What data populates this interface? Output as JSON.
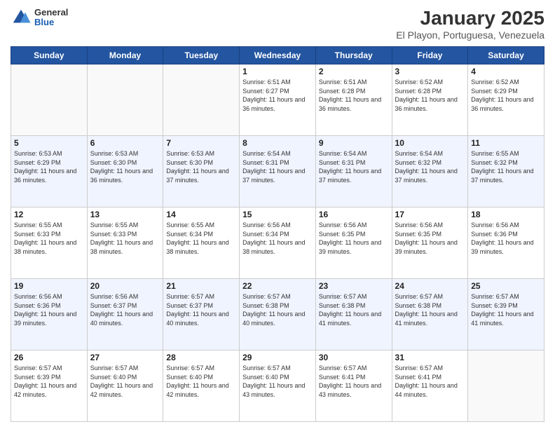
{
  "header": {
    "logo_general": "General",
    "logo_blue": "Blue",
    "main_title": "January 2025",
    "subtitle": "El Playon, Portuguesa, Venezuela"
  },
  "calendar": {
    "days_of_week": [
      "Sunday",
      "Monday",
      "Tuesday",
      "Wednesday",
      "Thursday",
      "Friday",
      "Saturday"
    ],
    "weeks": [
      [
        {
          "day": "",
          "sunrise": "",
          "sunset": "",
          "daylight": "",
          "empty": true
        },
        {
          "day": "",
          "sunrise": "",
          "sunset": "",
          "daylight": "",
          "empty": true
        },
        {
          "day": "",
          "sunrise": "",
          "sunset": "",
          "daylight": "",
          "empty": true
        },
        {
          "day": "1",
          "sunrise": "Sunrise: 6:51 AM",
          "sunset": "Sunset: 6:27 PM",
          "daylight": "Daylight: 11 hours and 36 minutes.",
          "empty": false
        },
        {
          "day": "2",
          "sunrise": "Sunrise: 6:51 AM",
          "sunset": "Sunset: 6:28 PM",
          "daylight": "Daylight: 11 hours and 36 minutes.",
          "empty": false
        },
        {
          "day": "3",
          "sunrise": "Sunrise: 6:52 AM",
          "sunset": "Sunset: 6:28 PM",
          "daylight": "Daylight: 11 hours and 36 minutes.",
          "empty": false
        },
        {
          "day": "4",
          "sunrise": "Sunrise: 6:52 AM",
          "sunset": "Sunset: 6:29 PM",
          "daylight": "Daylight: 11 hours and 36 minutes.",
          "empty": false
        }
      ],
      [
        {
          "day": "5",
          "sunrise": "Sunrise: 6:53 AM",
          "sunset": "Sunset: 6:29 PM",
          "daylight": "Daylight: 11 hours and 36 minutes.",
          "empty": false
        },
        {
          "day": "6",
          "sunrise": "Sunrise: 6:53 AM",
          "sunset": "Sunset: 6:30 PM",
          "daylight": "Daylight: 11 hours and 36 minutes.",
          "empty": false
        },
        {
          "day": "7",
          "sunrise": "Sunrise: 6:53 AM",
          "sunset": "Sunset: 6:30 PM",
          "daylight": "Daylight: 11 hours and 37 minutes.",
          "empty": false
        },
        {
          "day": "8",
          "sunrise": "Sunrise: 6:54 AM",
          "sunset": "Sunset: 6:31 PM",
          "daylight": "Daylight: 11 hours and 37 minutes.",
          "empty": false
        },
        {
          "day": "9",
          "sunrise": "Sunrise: 6:54 AM",
          "sunset": "Sunset: 6:31 PM",
          "daylight": "Daylight: 11 hours and 37 minutes.",
          "empty": false
        },
        {
          "day": "10",
          "sunrise": "Sunrise: 6:54 AM",
          "sunset": "Sunset: 6:32 PM",
          "daylight": "Daylight: 11 hours and 37 minutes.",
          "empty": false
        },
        {
          "day": "11",
          "sunrise": "Sunrise: 6:55 AM",
          "sunset": "Sunset: 6:32 PM",
          "daylight": "Daylight: 11 hours and 37 minutes.",
          "empty": false
        }
      ],
      [
        {
          "day": "12",
          "sunrise": "Sunrise: 6:55 AM",
          "sunset": "Sunset: 6:33 PM",
          "daylight": "Daylight: 11 hours and 38 minutes.",
          "empty": false
        },
        {
          "day": "13",
          "sunrise": "Sunrise: 6:55 AM",
          "sunset": "Sunset: 6:33 PM",
          "daylight": "Daylight: 11 hours and 38 minutes.",
          "empty": false
        },
        {
          "day": "14",
          "sunrise": "Sunrise: 6:55 AM",
          "sunset": "Sunset: 6:34 PM",
          "daylight": "Daylight: 11 hours and 38 minutes.",
          "empty": false
        },
        {
          "day": "15",
          "sunrise": "Sunrise: 6:56 AM",
          "sunset": "Sunset: 6:34 PM",
          "daylight": "Daylight: 11 hours and 38 minutes.",
          "empty": false
        },
        {
          "day": "16",
          "sunrise": "Sunrise: 6:56 AM",
          "sunset": "Sunset: 6:35 PM",
          "daylight": "Daylight: 11 hours and 39 minutes.",
          "empty": false
        },
        {
          "day": "17",
          "sunrise": "Sunrise: 6:56 AM",
          "sunset": "Sunset: 6:35 PM",
          "daylight": "Daylight: 11 hours and 39 minutes.",
          "empty": false
        },
        {
          "day": "18",
          "sunrise": "Sunrise: 6:56 AM",
          "sunset": "Sunset: 6:36 PM",
          "daylight": "Daylight: 11 hours and 39 minutes.",
          "empty": false
        }
      ],
      [
        {
          "day": "19",
          "sunrise": "Sunrise: 6:56 AM",
          "sunset": "Sunset: 6:36 PM",
          "daylight": "Daylight: 11 hours and 39 minutes.",
          "empty": false
        },
        {
          "day": "20",
          "sunrise": "Sunrise: 6:56 AM",
          "sunset": "Sunset: 6:37 PM",
          "daylight": "Daylight: 11 hours and 40 minutes.",
          "empty": false
        },
        {
          "day": "21",
          "sunrise": "Sunrise: 6:57 AM",
          "sunset": "Sunset: 6:37 PM",
          "daylight": "Daylight: 11 hours and 40 minutes.",
          "empty": false
        },
        {
          "day": "22",
          "sunrise": "Sunrise: 6:57 AM",
          "sunset": "Sunset: 6:38 PM",
          "daylight": "Daylight: 11 hours and 40 minutes.",
          "empty": false
        },
        {
          "day": "23",
          "sunrise": "Sunrise: 6:57 AM",
          "sunset": "Sunset: 6:38 PM",
          "daylight": "Daylight: 11 hours and 41 minutes.",
          "empty": false
        },
        {
          "day": "24",
          "sunrise": "Sunrise: 6:57 AM",
          "sunset": "Sunset: 6:38 PM",
          "daylight": "Daylight: 11 hours and 41 minutes.",
          "empty": false
        },
        {
          "day": "25",
          "sunrise": "Sunrise: 6:57 AM",
          "sunset": "Sunset: 6:39 PM",
          "daylight": "Daylight: 11 hours and 41 minutes.",
          "empty": false
        }
      ],
      [
        {
          "day": "26",
          "sunrise": "Sunrise: 6:57 AM",
          "sunset": "Sunset: 6:39 PM",
          "daylight": "Daylight: 11 hours and 42 minutes.",
          "empty": false
        },
        {
          "day": "27",
          "sunrise": "Sunrise: 6:57 AM",
          "sunset": "Sunset: 6:40 PM",
          "daylight": "Daylight: 11 hours and 42 minutes.",
          "empty": false
        },
        {
          "day": "28",
          "sunrise": "Sunrise: 6:57 AM",
          "sunset": "Sunset: 6:40 PM",
          "daylight": "Daylight: 11 hours and 42 minutes.",
          "empty": false
        },
        {
          "day": "29",
          "sunrise": "Sunrise: 6:57 AM",
          "sunset": "Sunset: 6:40 PM",
          "daylight": "Daylight: 11 hours and 43 minutes.",
          "empty": false
        },
        {
          "day": "30",
          "sunrise": "Sunrise: 6:57 AM",
          "sunset": "Sunset: 6:41 PM",
          "daylight": "Daylight: 11 hours and 43 minutes.",
          "empty": false
        },
        {
          "day": "31",
          "sunrise": "Sunrise: 6:57 AM",
          "sunset": "Sunset: 6:41 PM",
          "daylight": "Daylight: 11 hours and 44 minutes.",
          "empty": false
        },
        {
          "day": "",
          "sunrise": "",
          "sunset": "",
          "daylight": "",
          "empty": true
        }
      ]
    ]
  }
}
